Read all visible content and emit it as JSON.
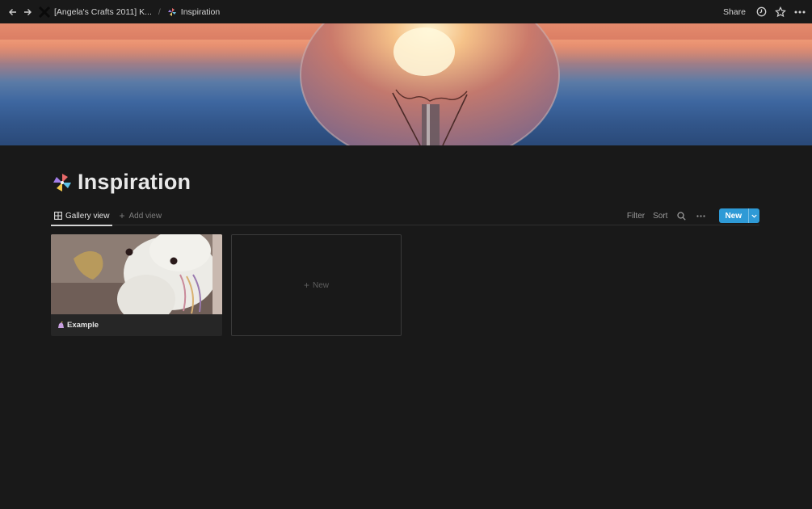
{
  "topbar": {
    "workspace_crumb": "[Angela's Crafts 2011] K...",
    "separator": "/",
    "page_crumb": "Inspiration",
    "share_label": "Share"
  },
  "page": {
    "title": "Inspiration"
  },
  "views": {
    "tabs": [
      {
        "label": "Gallery view",
        "icon": "grid-icon",
        "active": true
      }
    ],
    "add_view_label": "Add view",
    "filter_label": "Filter",
    "sort_label": "Sort",
    "new_label": "New"
  },
  "gallery": {
    "cards": [
      {
        "title": "Example",
        "icon": "unicorn-icon"
      }
    ],
    "new_card_label": "New"
  },
  "colors": {
    "background": "#191919",
    "accent": "#2e9ad6",
    "text": "#d4d4d4"
  }
}
